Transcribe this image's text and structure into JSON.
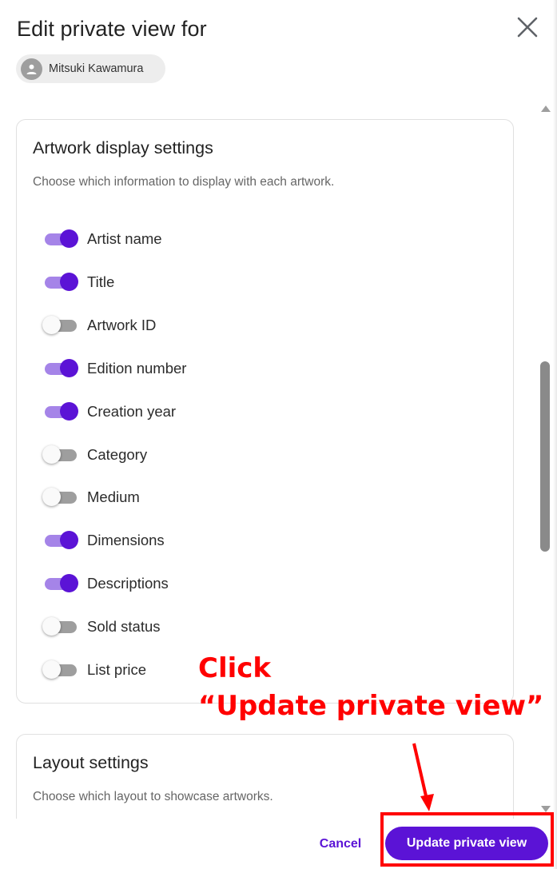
{
  "dialog": {
    "title": "Edit private view for",
    "close_icon": "close-icon",
    "recipient": {
      "name": "Mitsuki Kawamura",
      "icon": "person-icon"
    }
  },
  "artwork_settings": {
    "title": "Artwork display settings",
    "subtitle": "Choose which information to display with each artwork.",
    "toggles": [
      {
        "label": "Artist name",
        "on": true
      },
      {
        "label": "Title",
        "on": true
      },
      {
        "label": "Artwork ID",
        "on": false
      },
      {
        "label": "Edition number",
        "on": true
      },
      {
        "label": "Creation year",
        "on": true
      },
      {
        "label": "Category",
        "on": false
      },
      {
        "label": "Medium",
        "on": false
      },
      {
        "label": "Dimensions",
        "on": true
      },
      {
        "label": "Descriptions",
        "on": true
      },
      {
        "label": "Sold status",
        "on": false
      },
      {
        "label": "List price",
        "on": false
      }
    ]
  },
  "layout_settings": {
    "title": "Layout settings",
    "subtitle": "Choose which layout to showcase artworks."
  },
  "footer": {
    "cancel_label": "Cancel",
    "primary_label": "Update private view"
  },
  "annotation": {
    "line1": "Click",
    "line2": "“Update private view”",
    "color": "#ff0000"
  },
  "colors": {
    "accent": "#5b13d6",
    "toggle_track_on": "#a584e8",
    "toggle_track_off": "#9e9e9e"
  }
}
